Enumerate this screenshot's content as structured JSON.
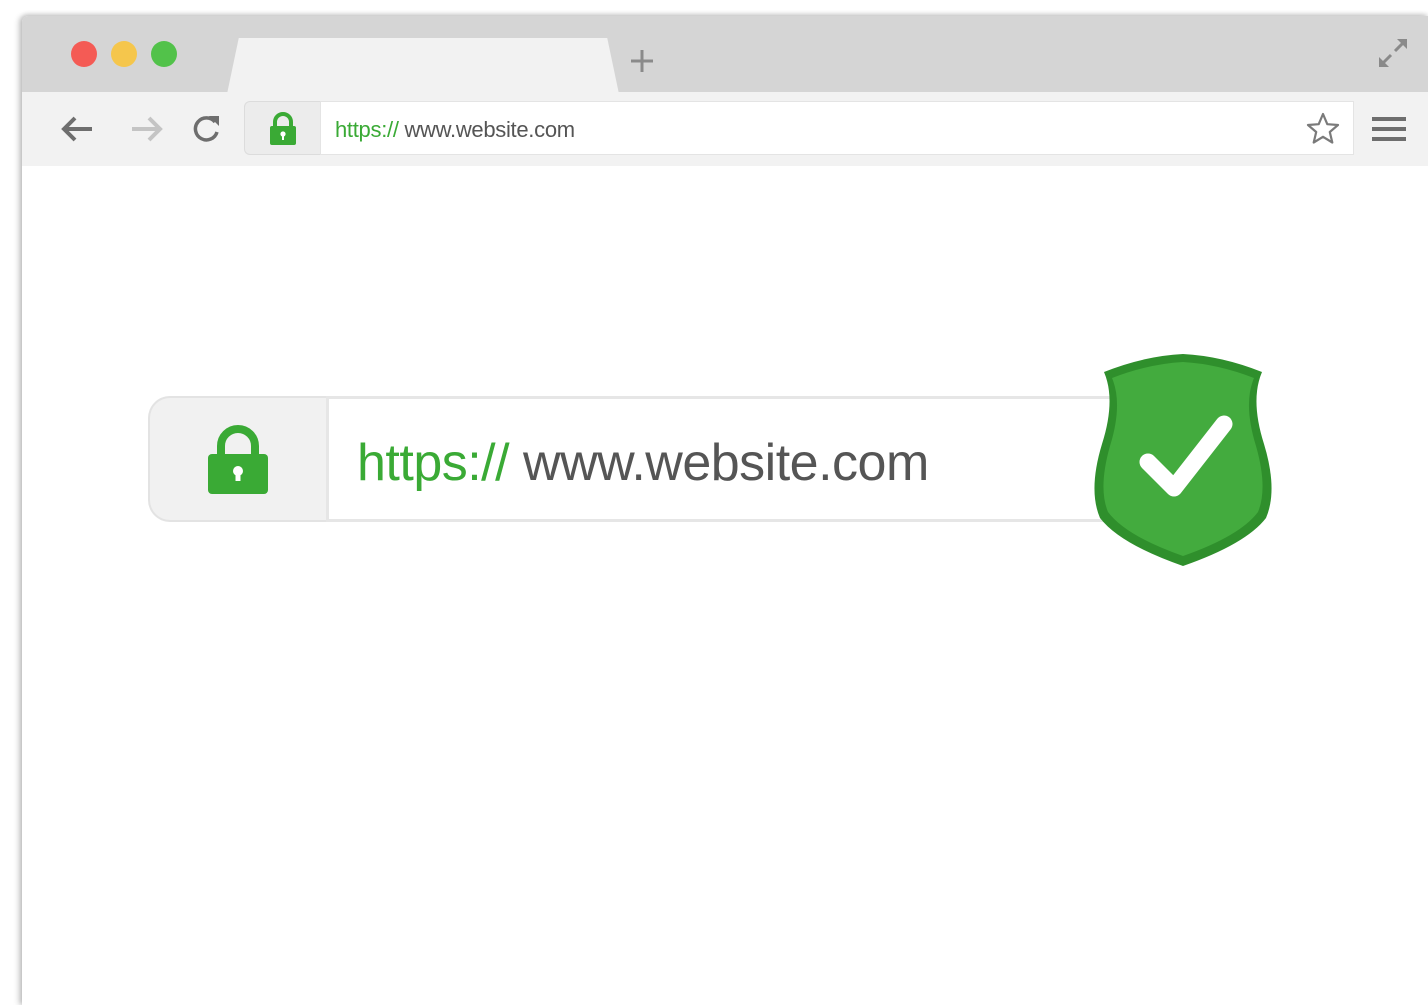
{
  "browser": {
    "window_controls": {
      "close_color": "#f45b55",
      "minimize_color": "#f5c64c",
      "maximize_color": "#52c24a"
    },
    "new_tab_icon": "plus-icon",
    "fullscreen_icon": "expand-arrows-icon"
  },
  "toolbar": {
    "back_icon": "arrow-left-icon",
    "forward_icon": "arrow-right-icon",
    "reload_icon": "reload-icon",
    "lock_icon": "lock-icon",
    "url_scheme": "https://",
    "url_host": " www.website.com",
    "bookmark_icon": "star-icon",
    "menu_icon": "hamburger-menu-icon"
  },
  "illustration": {
    "url_scheme": "https://",
    "url_host": " www.website.com",
    "lock_icon": "lock-icon",
    "badge_icon": "shield-check-icon"
  },
  "colors": {
    "secure_green": "#3aaa35",
    "url_gray": "#555555",
    "chrome_gray": "#d5d5d5",
    "toolbar_gray": "#f2f2f2"
  }
}
